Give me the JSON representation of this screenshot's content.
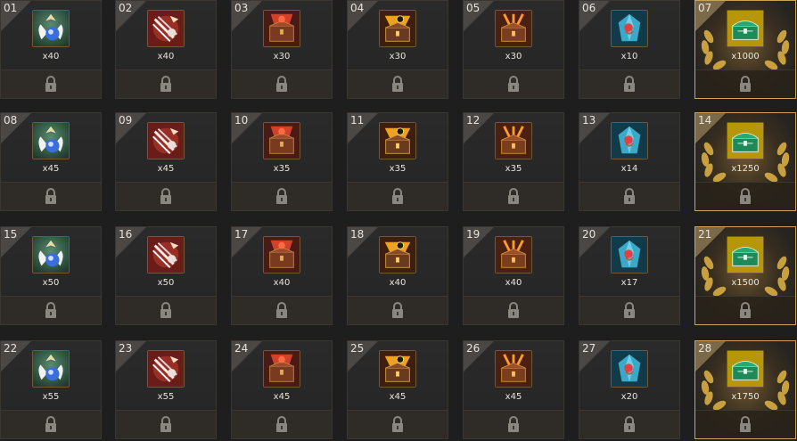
{
  "palette": {
    "cell_bg": "#262626",
    "gold_border": "#c8a55a",
    "text": "#e8e4dc"
  },
  "rewards": [
    {
      "num": "01",
      "qty": "x40",
      "icon": "angel-potion-icon",
      "special": false,
      "locked": true
    },
    {
      "num": "02",
      "qty": "x40",
      "icon": "arrows-shield-icon",
      "special": false,
      "locked": true
    },
    {
      "num": "03",
      "qty": "x30",
      "icon": "red-chest-icon",
      "special": false,
      "locked": true
    },
    {
      "num": "04",
      "qty": "x30",
      "icon": "gold-chest-icon",
      "special": false,
      "locked": true
    },
    {
      "num": "05",
      "qty": "x30",
      "icon": "orange-chest-icon",
      "special": false,
      "locked": true
    },
    {
      "num": "06",
      "qty": "x10",
      "icon": "blue-crystal-icon",
      "special": false,
      "locked": true
    },
    {
      "num": "07",
      "qty": "x1000",
      "icon": "green-chest-icon",
      "special": true,
      "locked": true
    },
    {
      "num": "08",
      "qty": "x45",
      "icon": "angel-potion-icon",
      "special": false,
      "locked": true
    },
    {
      "num": "09",
      "qty": "x45",
      "icon": "arrows-shield-icon",
      "special": false,
      "locked": true
    },
    {
      "num": "10",
      "qty": "x35",
      "icon": "red-chest-icon",
      "special": false,
      "locked": true
    },
    {
      "num": "11",
      "qty": "x35",
      "icon": "gold-chest-icon",
      "special": false,
      "locked": true
    },
    {
      "num": "12",
      "qty": "x35",
      "icon": "orange-chest-icon",
      "special": false,
      "locked": true
    },
    {
      "num": "13",
      "qty": "x14",
      "icon": "blue-crystal-icon",
      "special": false,
      "locked": true
    },
    {
      "num": "14",
      "qty": "x1250",
      "icon": "green-chest-icon",
      "special": true,
      "locked": true
    },
    {
      "num": "15",
      "qty": "x50",
      "icon": "angel-potion-icon",
      "special": false,
      "locked": true
    },
    {
      "num": "16",
      "qty": "x50",
      "icon": "arrows-shield-icon",
      "special": false,
      "locked": true
    },
    {
      "num": "17",
      "qty": "x40",
      "icon": "red-chest-icon",
      "special": false,
      "locked": true
    },
    {
      "num": "18",
      "qty": "x40",
      "icon": "gold-chest-icon",
      "special": false,
      "locked": true
    },
    {
      "num": "19",
      "qty": "x40",
      "icon": "orange-chest-icon",
      "special": false,
      "locked": true
    },
    {
      "num": "20",
      "qty": "x17",
      "icon": "blue-crystal-icon",
      "special": false,
      "locked": true
    },
    {
      "num": "21",
      "qty": "x1500",
      "icon": "green-chest-icon",
      "special": true,
      "locked": true
    },
    {
      "num": "22",
      "qty": "x55",
      "icon": "angel-potion-icon",
      "special": false,
      "locked": true
    },
    {
      "num": "23",
      "qty": "x55",
      "icon": "arrows-shield-icon",
      "special": false,
      "locked": true
    },
    {
      "num": "24",
      "qty": "x45",
      "icon": "red-chest-icon",
      "special": false,
      "locked": true
    },
    {
      "num": "25",
      "qty": "x45",
      "icon": "gold-chest-icon",
      "special": false,
      "locked": true
    },
    {
      "num": "26",
      "qty": "x45",
      "icon": "orange-chest-icon",
      "special": false,
      "locked": true
    },
    {
      "num": "27",
      "qty": "x20",
      "icon": "blue-crystal-icon",
      "special": false,
      "locked": true
    },
    {
      "num": "28",
      "qty": "x1750",
      "icon": "green-chest-icon",
      "special": true,
      "locked": true
    }
  ]
}
